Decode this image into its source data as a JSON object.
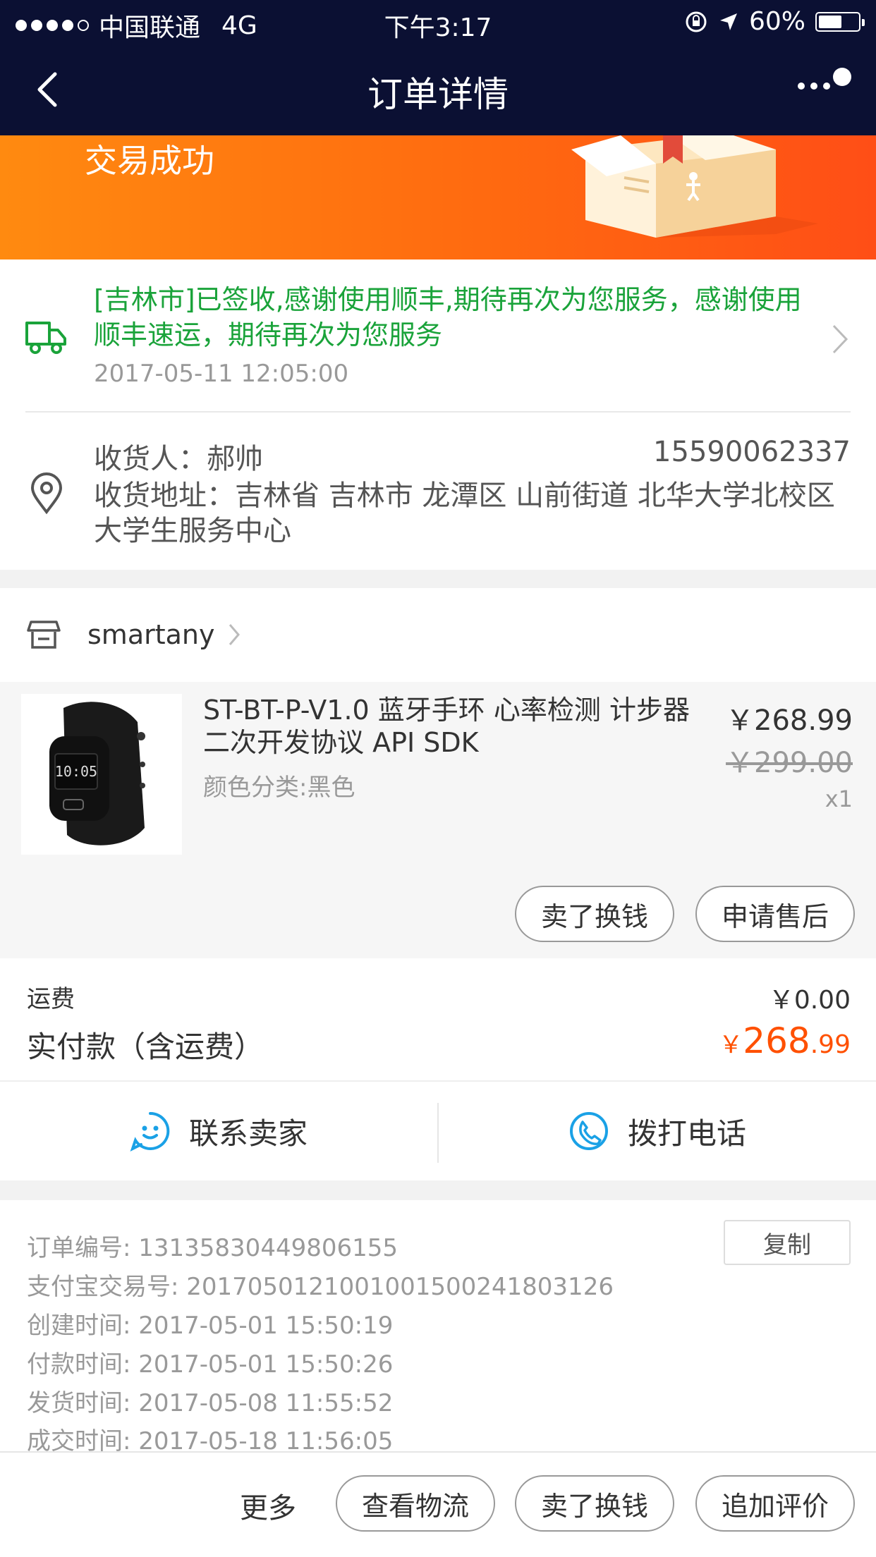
{
  "status_bar": {
    "carrier": "中国联通",
    "network": "4G",
    "time": "下午3:17",
    "battery": "60%"
  },
  "nav": {
    "title": "订单详情"
  },
  "banner": {
    "status": "交易成功"
  },
  "logistics": {
    "message": "[吉林市]已签收,感谢使用顺丰,期待再次为您服务，感谢使用顺丰速运，期待再次为您服务",
    "time": "2017-05-11 12:05:00"
  },
  "address": {
    "recipient": "收货人：郝帅",
    "phone": "15590062337",
    "address": "收货地址：吉林省 吉林市 龙潭区 山前街道 北华大学北校区大学生服务中心"
  },
  "shop": {
    "name": "smartany"
  },
  "item": {
    "title": "ST-BT-P-V1.0 蓝牙手环 心率检测 计步器 二次开发协议 API SDK",
    "sku": "颜色分类:黑色",
    "price": "￥268.99",
    "original_price": "￥299.00",
    "quantity": "x1",
    "watch_time": "10:05",
    "buttons": {
      "sell": "卖了换钱",
      "after_sales": "申请售后"
    }
  },
  "payment": {
    "shipping_label": "运费",
    "shipping_value": "￥0.00",
    "total_label": "实付款（含运费）",
    "total_currency": "￥",
    "total_int": "268",
    "total_dec": ".99"
  },
  "contact": {
    "seller": "联系卖家",
    "call": "拨打电话"
  },
  "order_info": {
    "copy": "复制",
    "rows": [
      "订单编号:   13135830449806155",
      "支付宝交易号:   2017050121001001500241803126",
      "创建时间:   2017-05-01 15:50:19",
      "付款时间:   2017-05-01 15:50:26",
      "发货时间:   2017-05-08 11:55:52",
      "成交时间:   2017-05-18 11:56:05"
    ]
  },
  "bottom_bar": {
    "more": "更多",
    "logistics": "查看物流",
    "sell": "卖了换钱",
    "review": "追加评价"
  },
  "colors": {
    "nav_bg": "#0b1033",
    "accent": "#ff5000",
    "logistics_green": "#1aa33a",
    "contact_blue": "#1aa1e6"
  }
}
